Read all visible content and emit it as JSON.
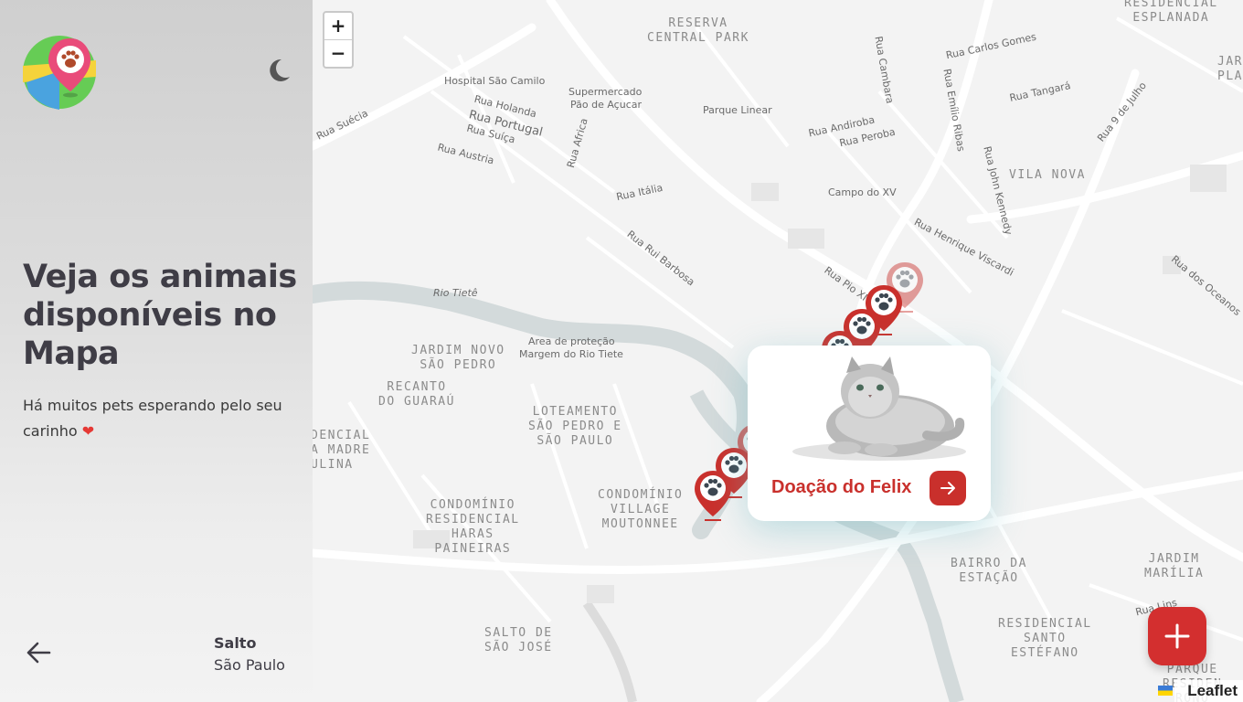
{
  "sidebar": {
    "headline": "Veja os animais disponíveis no Mapa",
    "subtext": "Há muitos pets esperando pelo seu carinho",
    "heart": "❤",
    "location": {
      "city": "Salto",
      "state": "São Paulo"
    }
  },
  "map": {
    "zoom_in": "+",
    "zoom_out": "−",
    "attribution": "Leaflet",
    "labels": [
      {
        "text": "Hospital São Camilo"
      },
      {
        "text": "Supermercado"
      },
      {
        "text": "Pão de Açucar"
      },
      {
        "text": "Parque Linear"
      },
      {
        "text": "Rua Holanda"
      },
      {
        "text": "Rua Portugal"
      },
      {
        "text": "Rua Suíça"
      },
      {
        "text": "Rua Austria"
      },
      {
        "text": "Rua Suécia"
      },
      {
        "text": "Rua Africa"
      },
      {
        "text": "Rua Itália"
      },
      {
        "text": "Rua Rui Barbosa"
      },
      {
        "text": "Rio Tietê"
      },
      {
        "text": "Area de proteção"
      },
      {
        "text": "Margem do Rio Tiete"
      },
      {
        "text": "Rua Cambara"
      },
      {
        "text": "Rua Carlos Gomes"
      },
      {
        "text": "Rua Emílio Ribas"
      },
      {
        "text": "Rua Tangará"
      },
      {
        "text": "Rua 9 de Julho"
      },
      {
        "text": "Rua Andiroba"
      },
      {
        "text": "Rua Peroba"
      },
      {
        "text": "Campo do XV"
      },
      {
        "text": "Rua John Kennedy"
      },
      {
        "text": "Rua Henrique Viscardi"
      },
      {
        "text": "Rua dos Oceanos"
      },
      {
        "text": "Rua Pio XI"
      },
      {
        "text": "Rua Lins"
      }
    ],
    "districts": [
      {
        "text": "RESERVA\nCENTRAL PARK"
      },
      {
        "text": "RESIDENCIAL\nESPLANADA"
      },
      {
        "text": "JARD\nPLAN"
      },
      {
        "text": "VILA NOVA"
      },
      {
        "text": "JARDIM NOVO\nSÃO PEDRO"
      },
      {
        "text": "RECANTO\nDO GUARAÚ"
      },
      {
        "text": "LOTEAMENTO\nSÃO PEDRO E\nSÃO PAULO"
      },
      {
        "text": "DENCIAL\nA MADRE\nULINA"
      },
      {
        "text": "CONDOMÍNIO\nVILLAGE\nMOUTONNEE"
      },
      {
        "text": "CONDOMÍNIO\nRESIDENCIAL\nHARAS\nPAINEIRAS"
      },
      {
        "text": "SALTO DE\nSÃO JOSÉ"
      },
      {
        "text": "BAIRRO DA\nESTAÇÃO"
      },
      {
        "text": "JARDIM\nMARÍLIA"
      },
      {
        "text": "RESIDENCIAL\nSANTO\nESTÉFANO"
      },
      {
        "text": "PARQUE\nRESIDEN\nRONO"
      }
    ]
  },
  "popup": {
    "title": "Doação do Felix"
  },
  "colors": {
    "accent": "#d32f2f",
    "text": "#3f3d46"
  }
}
